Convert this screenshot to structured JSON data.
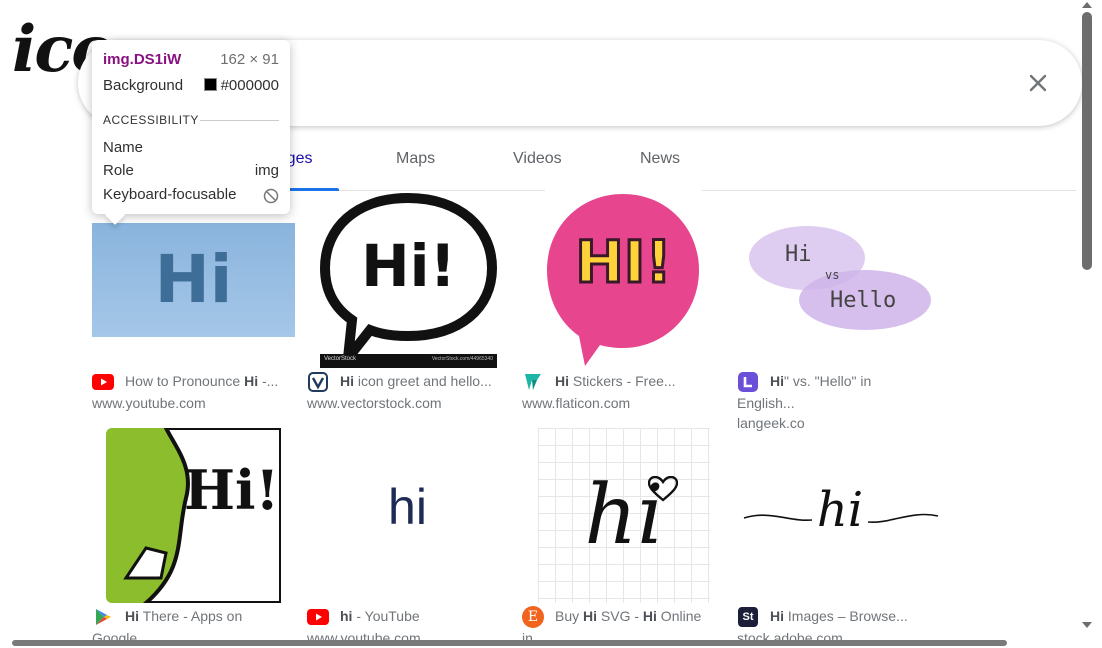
{
  "logo": {
    "text": "ico"
  },
  "search": {
    "clear_label": "×"
  },
  "tabs": [
    {
      "label": "Images"
    },
    {
      "label": "Maps"
    },
    {
      "label": "Videos"
    },
    {
      "label": "News"
    }
  ],
  "tooltip": {
    "selector": "img.DS1iW",
    "size": "162 × 91",
    "background_label": "Background",
    "background_value": "#000000",
    "section": "ACCESSIBILITY",
    "name_label": "Name",
    "role_label": "Role",
    "role_value": "img",
    "focus_label": "Keyboard-focusable"
  },
  "results": [
    {
      "bold": "",
      "title_pre": "How to Pronounce ",
      "title_bold": "Hi",
      "title_post": " -...",
      "site": "www.youtube.com",
      "favicon": "youtube-icon",
      "thumb_text": "Hi"
    },
    {
      "title_pre": "",
      "title_bold": "Hi",
      "title_post": " icon greet and hello...",
      "site": "www.vectorstock.com",
      "favicon": "vectorstock-icon",
      "thumb_text": "Hi!",
      "thumb_foot_left": "VectorStock",
      "thumb_foot_right": "VectorStock.com/44965340"
    },
    {
      "title_pre": "",
      "title_bold": "Hi",
      "title_post": " Stickers - Free...",
      "site": "www.flaticon.com",
      "favicon": "flaticon-icon",
      "thumb_text": "HI!"
    },
    {
      "title_pre": "",
      "title_bold": "Hi",
      "title_post": "\" vs. \"Hello\" in",
      "title_line2": "English...",
      "site": "langeek.co",
      "favicon": "langeek-icon",
      "thumb_hi": "Hi",
      "thumb_vs": "vs",
      "thumb_hello": "Hello"
    },
    {
      "title_pre": "",
      "title_bold": "Hi",
      "title_post": " There - Apps on",
      "site": "Google",
      "favicon": "google-play-icon",
      "thumb_text": "Hi!"
    },
    {
      "title_pre": "",
      "title_bold": "hi",
      "title_post": " - YouTube",
      "site": "www.youtube.com",
      "favicon": "youtube-icon",
      "thumb_text": "hi"
    },
    {
      "title_pre": "Buy ",
      "title_bold": "Hi",
      "title_mid": " SVG - ",
      "title_bold2": "Hi",
      "title_post": " Online",
      "site": "in...",
      "favicon": "etsy-icon",
      "favicon_letter": "E",
      "thumb_text": "hi"
    },
    {
      "title_pre": "",
      "title_bold": "Hi",
      "title_post": " Images – Browse...",
      "site": "stock.adobe.com",
      "favicon": "adobe-stock-icon",
      "favicon_letter": "St",
      "thumb_text": "hi"
    }
  ],
  "colors": {
    "accent": "#1a73e8",
    "youtube": "#ff0000",
    "flaticon": "#1cb5a6",
    "langeek": "#6b4fd8",
    "etsy": "#f1641e"
  }
}
